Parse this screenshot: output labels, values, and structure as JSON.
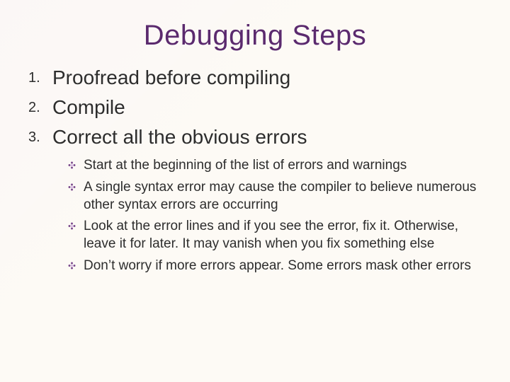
{
  "title": "Debugging Steps",
  "main_items": [
    {
      "text": "Proofread before compiling"
    },
    {
      "text": "Compile"
    },
    {
      "text": "Correct all the obvious errors"
    }
  ],
  "sub_items": [
    {
      "text": "Start at the beginning of the list of errors and warnings"
    },
    {
      "text": "A single syntax error may cause the compiler to believe numerous other syntax errors are occurring"
    },
    {
      "text": "Look at the error lines and if you see the error, fix it. Otherwise, leave it for later. It may vanish when you fix something else"
    },
    {
      "text": "Don’t worry if more errors appear. Some errors mask other errors"
    }
  ],
  "colors": {
    "title": "#5b2a6e",
    "text": "#2d2d2d",
    "background": "#fdfaf5"
  }
}
